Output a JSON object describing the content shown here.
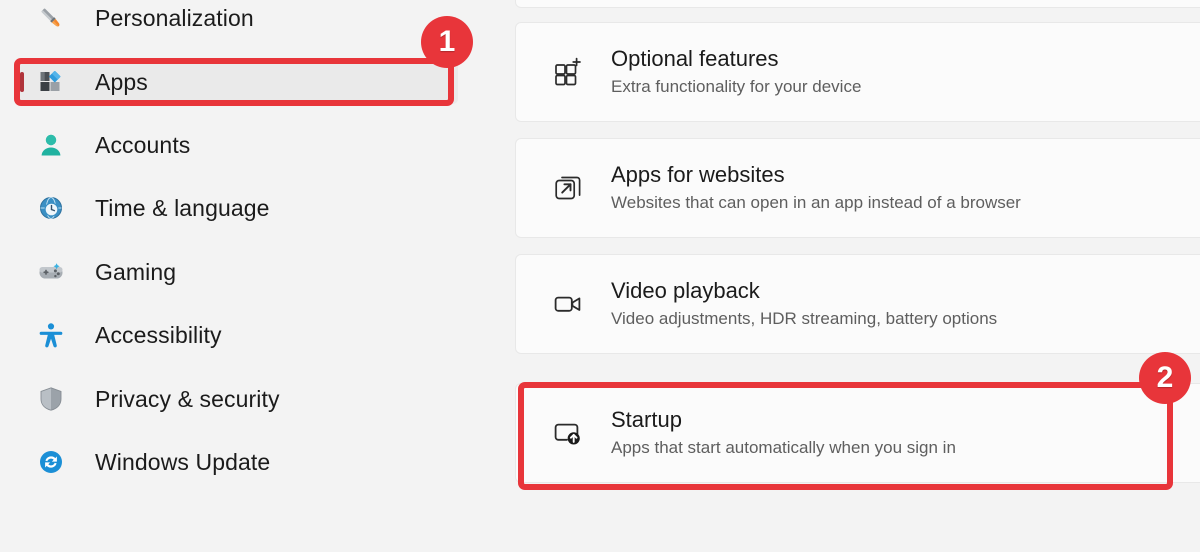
{
  "theme": {
    "background": "#f3f3f3",
    "card_background": "#fbfbfb",
    "card_border": "#e8e8e8",
    "selected_item_background": "#eaeaea",
    "selection_accent": "#b0343b",
    "annotation_red": "#e8353a",
    "title_text": "#1b1b1b",
    "subtitle_text": "#5e5e5e"
  },
  "sidebar": {
    "items": [
      {
        "label": "Personalization",
        "icon": "paintbrush-icon",
        "selected": false
      },
      {
        "label": "Apps",
        "icon": "apps-icon",
        "selected": true
      },
      {
        "label": "Accounts",
        "icon": "person-icon",
        "selected": false
      },
      {
        "label": "Time & language",
        "icon": "clock-globe-icon",
        "selected": false
      },
      {
        "label": "Gaming",
        "icon": "gamepad-icon",
        "selected": false
      },
      {
        "label": "Accessibility",
        "icon": "accessibility-person-icon",
        "selected": false
      },
      {
        "label": "Privacy & security",
        "icon": "shield-icon",
        "selected": false
      },
      {
        "label": "Windows Update",
        "icon": "refresh-circle-icon",
        "selected": false
      }
    ]
  },
  "content": {
    "cards": [
      {
        "title": "Optional features",
        "subtitle": "Extra functionality for your device",
        "icon": "grid-plus-icon",
        "highlighted": false
      },
      {
        "title": "Apps for websites",
        "subtitle": "Websites that can open in an app instead of a browser",
        "icon": "external-link-icon",
        "highlighted": false
      },
      {
        "title": "Video playback",
        "subtitle": "Video adjustments, HDR streaming, battery options",
        "icon": "video-camera-icon",
        "highlighted": false
      },
      {
        "title": "Startup",
        "subtitle": "Apps that start automatically when you sign in",
        "icon": "startup-arrow-icon",
        "highlighted": true
      }
    ]
  },
  "annotations": {
    "badges": [
      {
        "number": "1",
        "target": "sidebar-item-apps"
      },
      {
        "number": "2",
        "target": "card-startup"
      }
    ]
  }
}
